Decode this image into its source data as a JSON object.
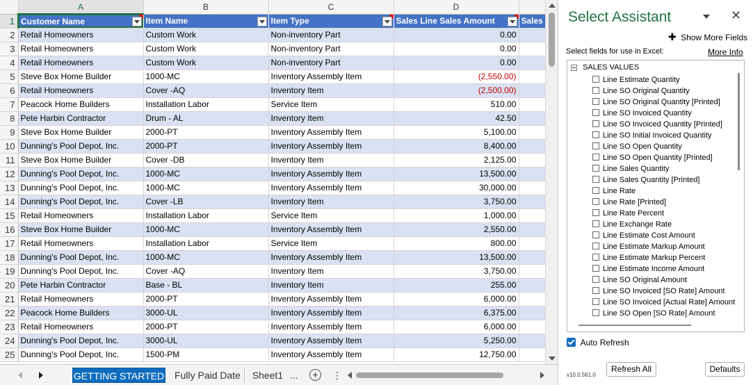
{
  "sheet": {
    "col_letters": [
      "A",
      "B",
      "C",
      "D"
    ],
    "active_col": "A",
    "active_row": 1,
    "headers": [
      "Customer Name",
      "Item Name",
      "Item Type",
      "Sales Line Sales Amount",
      "Sales L"
    ],
    "rows": [
      {
        "num": "2",
        "a": "Retail Homeowners",
        "b": "Custom Work",
        "c": "Non-inventory Part",
        "d": "0.00",
        "neg": false
      },
      {
        "num": "3",
        "a": "Retail Homeowners",
        "b": "Custom Work",
        "c": "Non-inventory Part",
        "d": "0.00",
        "neg": false
      },
      {
        "num": "4",
        "a": "Retail Homeowners",
        "b": "Custom Work",
        "c": "Non-inventory Part",
        "d": "0.00",
        "neg": false
      },
      {
        "num": "5",
        "a": "Steve Box Home Builder",
        "b": "1000-MC",
        "c": "Inventory Assembly Item",
        "d": "(2,550.00)",
        "neg": true
      },
      {
        "num": "6",
        "a": "Retail Homeowners",
        "b": "Cover -AQ",
        "c": "Inventory Item",
        "d": "(2,500.00)",
        "neg": true
      },
      {
        "num": "7",
        "a": "Peacock Home Builders",
        "b": "Installation Labor",
        "c": "Service Item",
        "d": "510.00",
        "neg": false
      },
      {
        "num": "8",
        "a": "Pete Harbin Contractor",
        "b": "Drum - AL",
        "c": "Inventory Item",
        "d": "42.50",
        "neg": false
      },
      {
        "num": "9",
        "a": "Steve Box Home Builder",
        "b": "2000-PT",
        "c": "Inventory Assembly Item",
        "d": "5,100.00",
        "neg": false
      },
      {
        "num": "10",
        "a": "Dunning's Pool Depot, Inc.",
        "b": "2000-PT",
        "c": "Inventory Assembly Item",
        "d": "8,400.00",
        "neg": false
      },
      {
        "num": "11",
        "a": "Steve Box Home Builder",
        "b": "Cover -DB",
        "c": "Inventory Item",
        "d": "2,125.00",
        "neg": false
      },
      {
        "num": "12",
        "a": "Dunning's Pool Depot, Inc.",
        "b": "1000-MC",
        "c": "Inventory Assembly Item",
        "d": "13,500.00",
        "neg": false
      },
      {
        "num": "13",
        "a": "Dunning's Pool Depot, Inc.",
        "b": "1000-MC",
        "c": "Inventory Assembly Item",
        "d": "30,000.00",
        "neg": false
      },
      {
        "num": "14",
        "a": "Dunning's Pool Depot, Inc.",
        "b": "Cover -LB",
        "c": "Inventory Item",
        "d": "3,750.00",
        "neg": false
      },
      {
        "num": "15",
        "a": "Retail Homeowners",
        "b": "Installation Labor",
        "c": "Service Item",
        "d": "1,000.00",
        "neg": false
      },
      {
        "num": "16",
        "a": "Steve Box Home Builder",
        "b": "1000-MC",
        "c": "Inventory Assembly Item",
        "d": "2,550.00",
        "neg": false
      },
      {
        "num": "17",
        "a": "Retail Homeowners",
        "b": "Installation Labor",
        "c": "Service Item",
        "d": "800.00",
        "neg": false
      },
      {
        "num": "18",
        "a": "Dunning's Pool Depot, Inc.",
        "b": "1000-MC",
        "c": "Inventory Assembly Item",
        "d": "13,500.00",
        "neg": false
      },
      {
        "num": "19",
        "a": "Dunning's Pool Depot, Inc.",
        "b": "Cover -AQ",
        "c": "Inventory Item",
        "d": "3,750.00",
        "neg": false
      },
      {
        "num": "20",
        "a": "Pete Harbin Contractor",
        "b": "Base - BL",
        "c": "Inventory Item",
        "d": "255.00",
        "neg": false
      },
      {
        "num": "21",
        "a": "Retail Homeowners",
        "b": "2000-PT",
        "c": "Inventory Assembly Item",
        "d": "6,000.00",
        "neg": false
      },
      {
        "num": "22",
        "a": "Peacock Home Builders",
        "b": "3000-UL",
        "c": "Inventory Assembly Item",
        "d": "6,375.00",
        "neg": false
      },
      {
        "num": "23",
        "a": "Retail Homeowners",
        "b": "2000-PT",
        "c": "Inventory Assembly Item",
        "d": "6,000.00",
        "neg": false
      },
      {
        "num": "24",
        "a": "Dunning's Pool Depot, Inc.",
        "b": "3000-UL",
        "c": "Inventory Assembly Item",
        "d": "5,250.00",
        "neg": false
      },
      {
        "num": "25",
        "a": "Dunning's Pool Depot, Inc.",
        "b": "1500-PM",
        "c": "Inventory Assembly Item",
        "d": "12,750.00",
        "neg": false
      }
    ]
  },
  "tabs": {
    "items": [
      "GETTING STARTED",
      "Fully Paid Date",
      "Sheet1"
    ],
    "active": "GETTING STARTED",
    "more": "...",
    "add": "+",
    "vdots": "⋮"
  },
  "pane": {
    "title": "Select Assistant",
    "close": "✕",
    "show_more_plus": "✚",
    "show_more": "Show More Fields",
    "select_label": "Select fields for use in Excel:",
    "more_info": "More Info",
    "group": "SALES VALUES",
    "fields": [
      "Line Estimate Quantity",
      "Line SO Original Quantity",
      "Line SO Original Quantity [Printed]",
      "Line SO Invoiced Quantity",
      "Line SO Invoiced Quantity [Printed]",
      "Line SO Initial Invoiced Quantity",
      "Line SO Open Quantity",
      "Line SO Open Quantity [Printed]",
      "Line Sales Quantity",
      "Line Sales Quantity [Printed]",
      "Line Rate",
      "Line Rate [Printed]",
      "Line Rate Percent",
      "Line Exchange Rate",
      "Line Estimate Cost Amount",
      "Line Estimate Markup Amount",
      "Line Estimate Markup Percent",
      "Line Estimate Income Amount",
      "Line SO Original Amount",
      "Line SO Invoiced [SO Rate] Amount",
      "Line SO Invoiced [Actual Rate] Amount",
      "Line SO Open [SO Rate] Amount"
    ],
    "auto_refresh": "Auto Refresh",
    "auto_refresh_checked": true,
    "version": "v10.0.561.0",
    "refresh_all": "Refresh All",
    "defaults": "Defaults"
  }
}
